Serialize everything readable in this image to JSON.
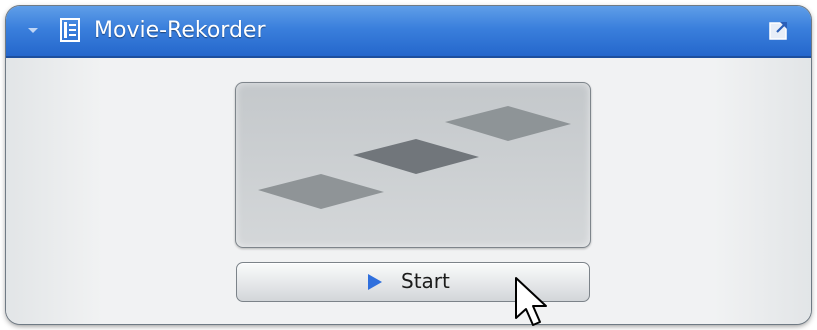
{
  "panel": {
    "title": "Movie-Rekorder",
    "icons": {
      "collapse": "chevron-down-icon",
      "app": "film-icon",
      "detach": "external-window-icon"
    },
    "accent_color": "#2f76d8"
  },
  "preview": {
    "icon": "stacked-frames-icon"
  },
  "start_button": {
    "label": "Start",
    "icon": "play-icon",
    "icon_color": "#2f6fdd"
  },
  "pointer": {
    "icon": "mouse-cursor-icon"
  }
}
